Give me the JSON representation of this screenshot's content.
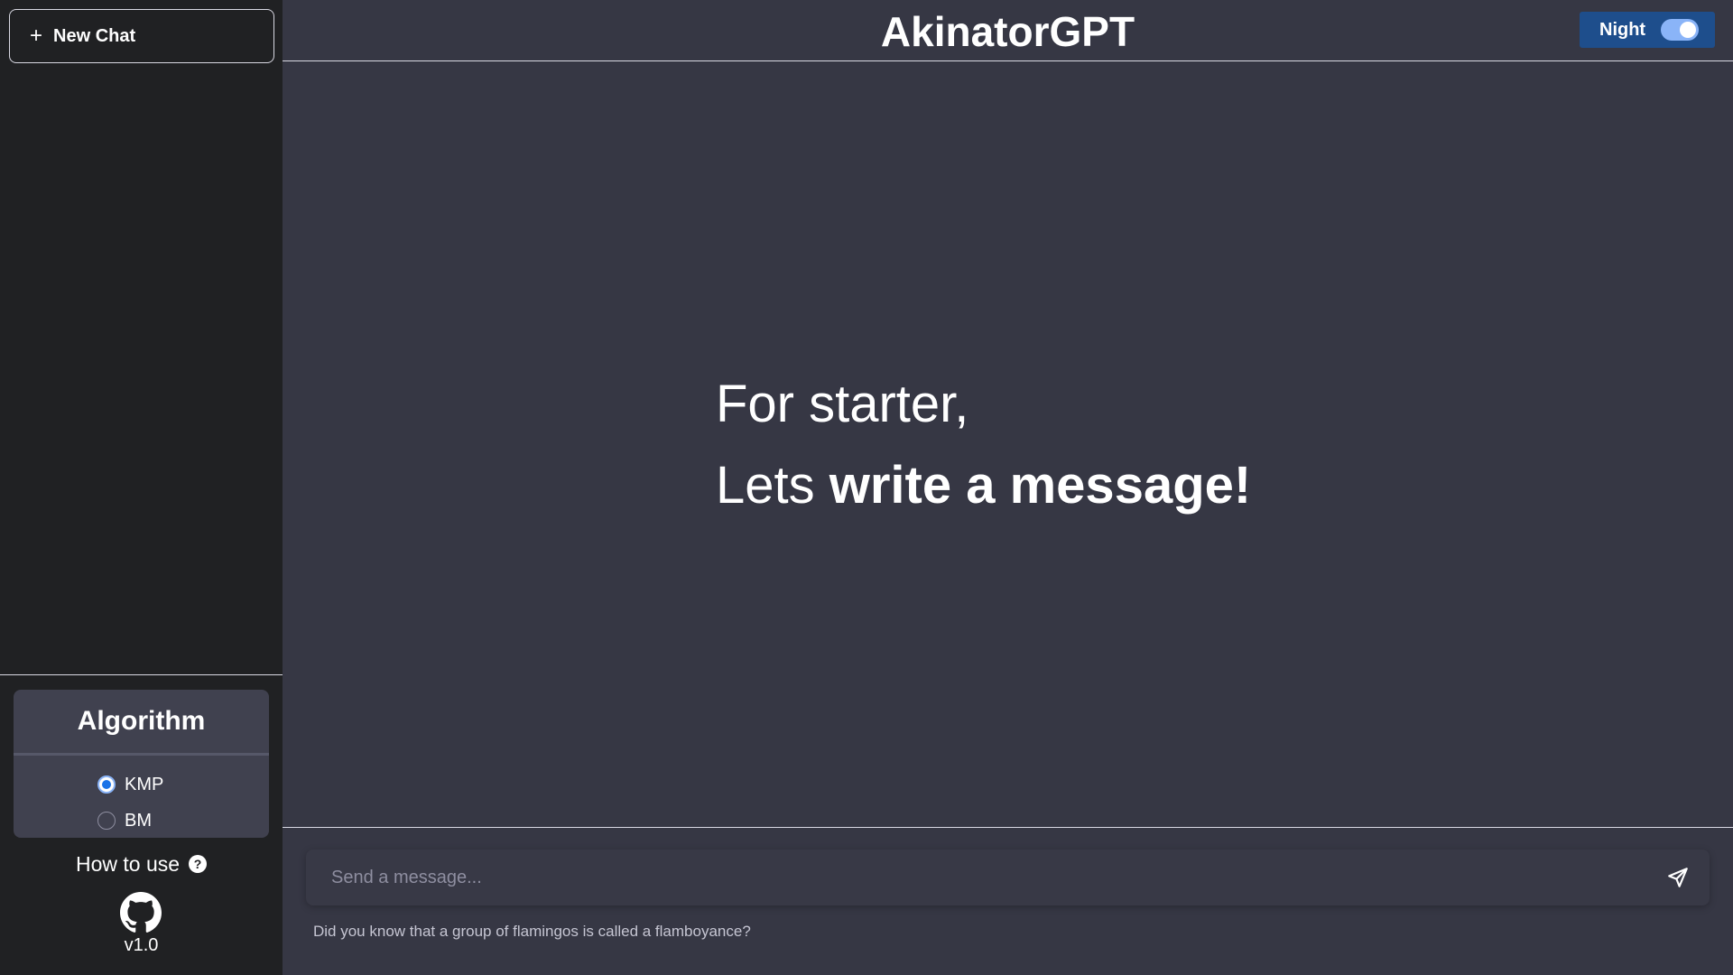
{
  "sidebar": {
    "new_chat": {
      "icon": "plus-icon",
      "label": "New Chat"
    },
    "algorithm": {
      "title": "Algorithm",
      "options": [
        {
          "label": "KMP",
          "selected": true
        },
        {
          "label": "BM",
          "selected": false
        }
      ]
    },
    "how_to_use": {
      "label": "How to use",
      "icon": "help-icon",
      "icon_glyph": "?"
    },
    "github_icon": "github-icon",
    "version": "v1.0"
  },
  "header": {
    "title": "AkinatorGPT",
    "theme_toggle": {
      "label": "Night",
      "enabled": true
    }
  },
  "main": {
    "welcome_line1": "For starter,",
    "welcome_line2_prefix": "Lets ",
    "welcome_line2_bold": "write a message!"
  },
  "composer": {
    "placeholder": "Send a message...",
    "value": "",
    "send_icon": "send-icon",
    "fun_fact": "Did you know that a group of flamingos is called a flamboyance?"
  },
  "colors": {
    "sidebar_bg": "#202123",
    "main_bg": "#363744",
    "panel_bg": "#40414f",
    "toggle_bg": "#1e4e8c",
    "accent": "#8ab4f8"
  }
}
